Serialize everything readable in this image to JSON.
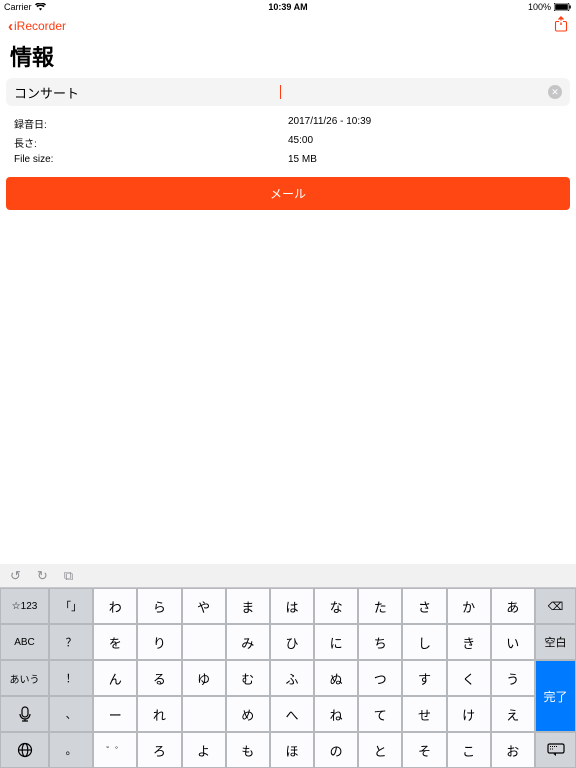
{
  "status": {
    "carrier": "Carrier",
    "wifi": "wifi",
    "time": "10:39 AM",
    "battery_pct": "100%"
  },
  "nav": {
    "back_label": "iRecorder"
  },
  "page": {
    "title": "情報"
  },
  "name_field": {
    "value": "コンサート"
  },
  "info": {
    "rows": [
      {
        "label": "録音日:",
        "value": "2017/11/26 - 10:39"
      },
      {
        "label": "長さ:",
        "value": "45:00"
      },
      {
        "label": "File size:",
        "value": "15 MB"
      }
    ]
  },
  "actions": {
    "mail": "メール"
  },
  "keyboard": {
    "toolbar": {
      "undo": "↺",
      "redo": "↻",
      "clipboard": "⧉"
    },
    "left_cols": [
      "☆123",
      "ABC",
      "あいう",
      "mic",
      "globe"
    ],
    "right_actions": {
      "backspace": "⌫",
      "space": "空白",
      "done": "完了",
      "dismiss": "⌨"
    },
    "rows": [
      [
        "「」",
        "わ",
        "ら",
        "や",
        "ま",
        "は",
        "な",
        "た",
        "さ",
        "か",
        "あ"
      ],
      [
        "？",
        "を",
        "り",
        "",
        "み",
        "ひ",
        "に",
        "ち",
        "し",
        "き",
        "い"
      ],
      [
        "！",
        "ん",
        "る",
        "ゆ",
        "む",
        "ふ",
        "ぬ",
        "つ",
        "す",
        "く",
        "う"
      ],
      [
        "、",
        "ー",
        "れ",
        "",
        "め",
        "へ",
        "ね",
        "て",
        "せ",
        "け",
        "え"
      ],
      [
        "。",
        "〜",
        "ろ",
        "よ",
        "も",
        "ほ",
        "の",
        "と",
        "そ",
        "こ",
        "お"
      ]
    ],
    "left_labels": {
      "num": "☆123",
      "abc": "ABC",
      "kana": "あいう"
    },
    "punct_small": "゛゜"
  }
}
